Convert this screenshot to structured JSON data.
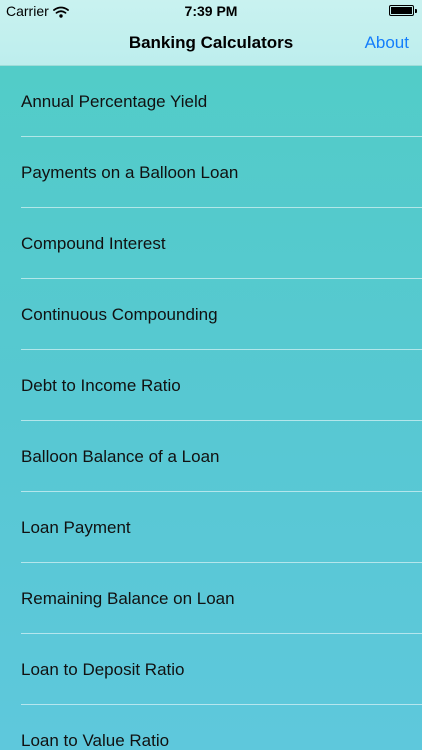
{
  "status_bar": {
    "carrier": "Carrier",
    "time": "7:39 PM"
  },
  "nav": {
    "title": "Banking Calculators",
    "about_label": "About"
  },
  "list": {
    "items": [
      {
        "label": "Annual Percentage Yield"
      },
      {
        "label": "Payments on a Balloon Loan"
      },
      {
        "label": "Compound Interest"
      },
      {
        "label": "Continuous Compounding"
      },
      {
        "label": "Debt to Income Ratio"
      },
      {
        "label": "Balloon Balance of a Loan"
      },
      {
        "label": "Loan Payment"
      },
      {
        "label": "Remaining Balance on Loan"
      },
      {
        "label": "Loan to Deposit Ratio"
      },
      {
        "label": "Loan to Value Ratio"
      }
    ]
  },
  "colors": {
    "accent": "#147efb",
    "nav_background": "#c3f0ef",
    "list_background_top": "#52ccc8",
    "list_background_bottom": "#5ec8dc"
  }
}
